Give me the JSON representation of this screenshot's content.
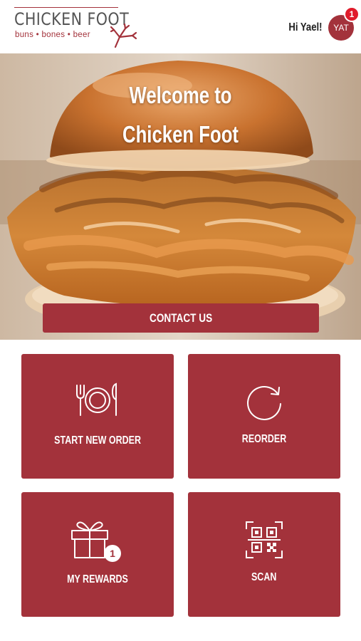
{
  "header": {
    "logo_title": "CHICKEN FOOT",
    "logo_tagline": "buns • bones • beer",
    "greeting": "Hi Yael!",
    "avatar_initials": "YAT",
    "notification_count": "1"
  },
  "hero": {
    "welcome_line1": "Welcome to",
    "welcome_line2": "Chicken Foot",
    "contact_label": "CONTACT US"
  },
  "tiles": [
    {
      "label": "START NEW ORDER",
      "icon": "plate-fork-knife-icon"
    },
    {
      "label": "REORDER",
      "icon": "reorder-refresh-icon"
    },
    {
      "label": "MY REWARDS",
      "icon": "gift-icon",
      "badge": "1"
    },
    {
      "label": "SCAN",
      "icon": "qr-code-icon"
    }
  ],
  "colors": {
    "brand": "#a3323b",
    "notification": "#e01b2b"
  }
}
